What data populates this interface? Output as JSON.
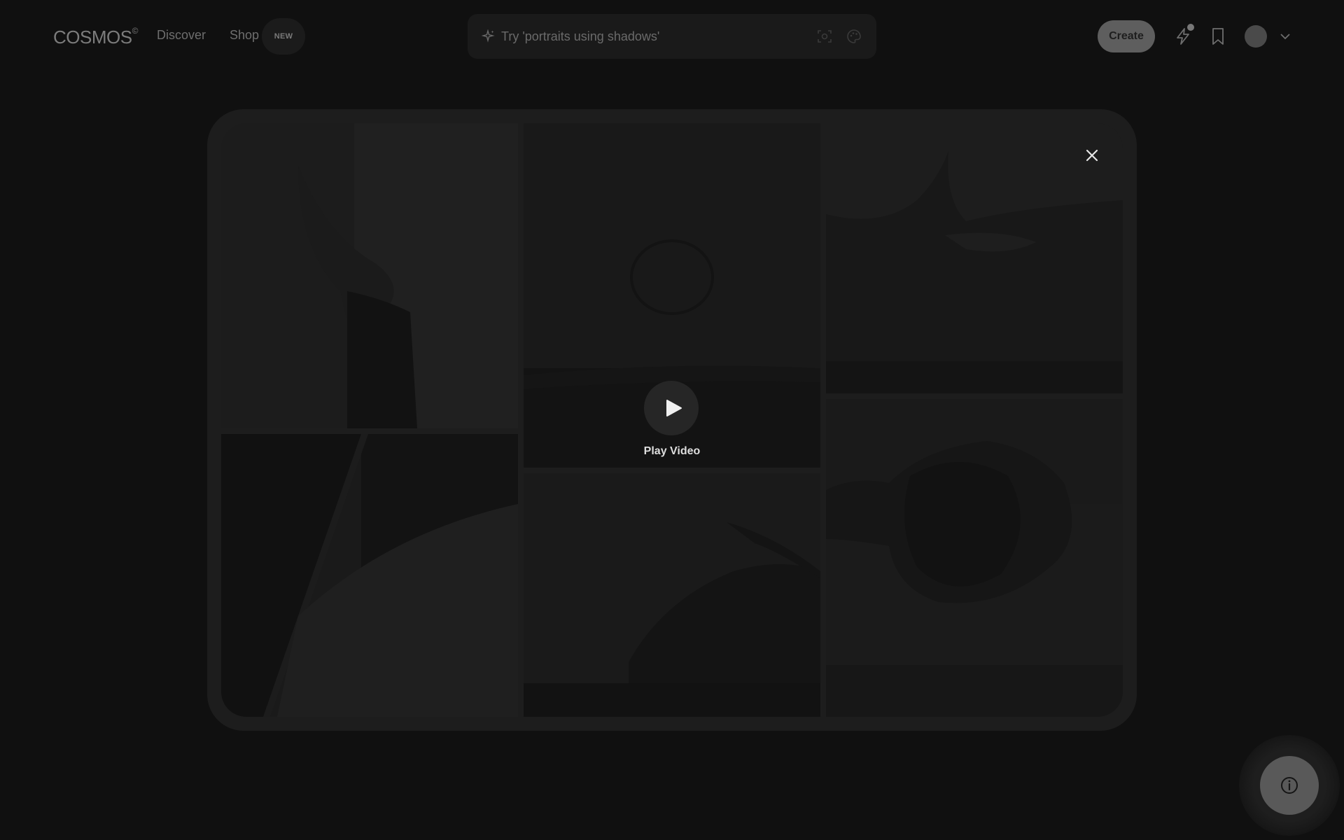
{
  "header": {
    "logo": "COSMOS",
    "logo_mark": "©",
    "nav": {
      "discover": "Discover",
      "shop": "Shop",
      "shop_badge": "NEW"
    },
    "search": {
      "placeholder": "Try 'portraits using shadows'",
      "value": "",
      "left_icon": "sparkle-icon",
      "right_icons": [
        "visual-search-icon",
        "palette-icon"
      ]
    },
    "create_label": "Create",
    "icons": [
      "bolt-icon",
      "bookmark-icon",
      "avatar",
      "chevron-down-icon"
    ]
  },
  "modal": {
    "play_label": "Play Video",
    "close_icon": "close-icon",
    "tiles": [
      "top-left-tile",
      "top-center-tile",
      "top-right-tile",
      "bottom-left-tile",
      "bottom-center-tile",
      "bottom-right-tile"
    ]
  },
  "info_button": {
    "icon": "info-icon"
  },
  "colors": {
    "background": "#101010",
    "modal": "#1d1d1d",
    "create_button": "#5e5e5e",
    "play_label": "#dedede"
  }
}
